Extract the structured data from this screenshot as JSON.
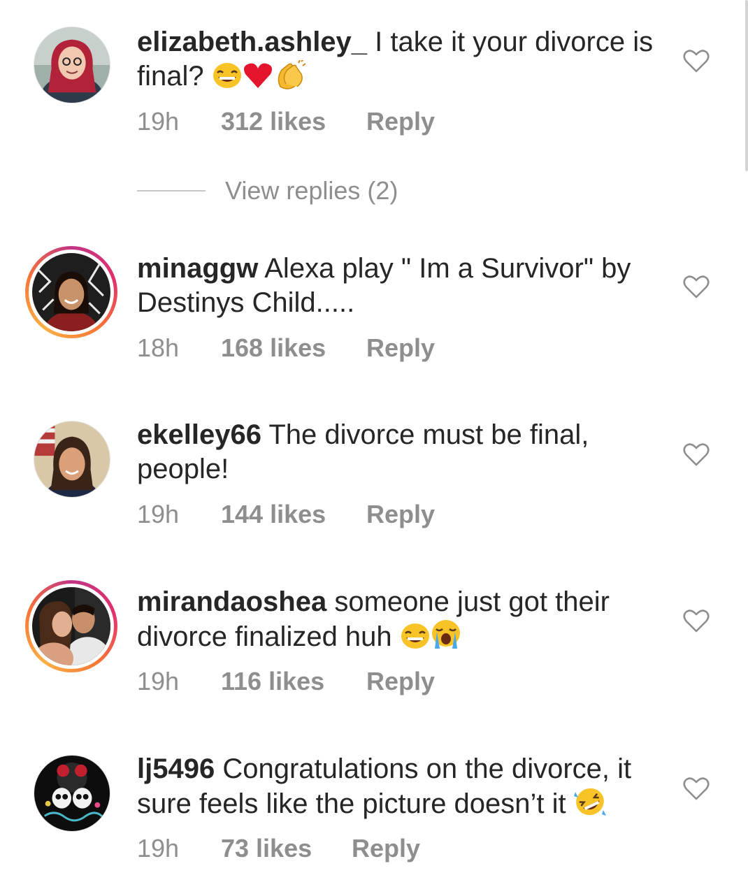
{
  "comments": [
    {
      "username": "elizabeth.ashley_",
      "text": "I take it your divorce is final?",
      "emojis": [
        "laughing-face",
        "red-heart",
        "clapping-hands"
      ],
      "time": "19h",
      "likes": "312 likes",
      "reply": "Reply",
      "story_ring": false
    },
    {
      "username": "minaggw",
      "text": "Alexa play \" Im a Survivor\" by Destinys Child.....",
      "emojis": [],
      "time": "18h",
      "likes": "168 likes",
      "reply": "Reply",
      "story_ring": true
    },
    {
      "username": "ekelley66",
      "text": "The divorce must be final, people!",
      "emojis": [],
      "time": "19h",
      "likes": "144 likes",
      "reply": "Reply",
      "story_ring": false
    },
    {
      "username": "mirandaoshea",
      "text": "someone just got their divorce finalized huh",
      "emojis": [
        "laughing-face",
        "crying-face"
      ],
      "time": "19h",
      "likes": "116 likes",
      "reply": "Reply",
      "story_ring": true
    },
    {
      "username": "lj5496",
      "text": "Congratulations on the divorce, it sure feels like the picture doesn’t it",
      "emojis": [
        "rolling-laughing-face"
      ],
      "time": "19h",
      "likes": "73 likes",
      "reply": "Reply",
      "story_ring": false
    }
  ],
  "view_replies": "View replies (2)",
  "colors": {
    "text": "#262626",
    "meta": "#8e8e8e",
    "ring_start": "#c13584",
    "ring_end": "#fcaf45"
  }
}
